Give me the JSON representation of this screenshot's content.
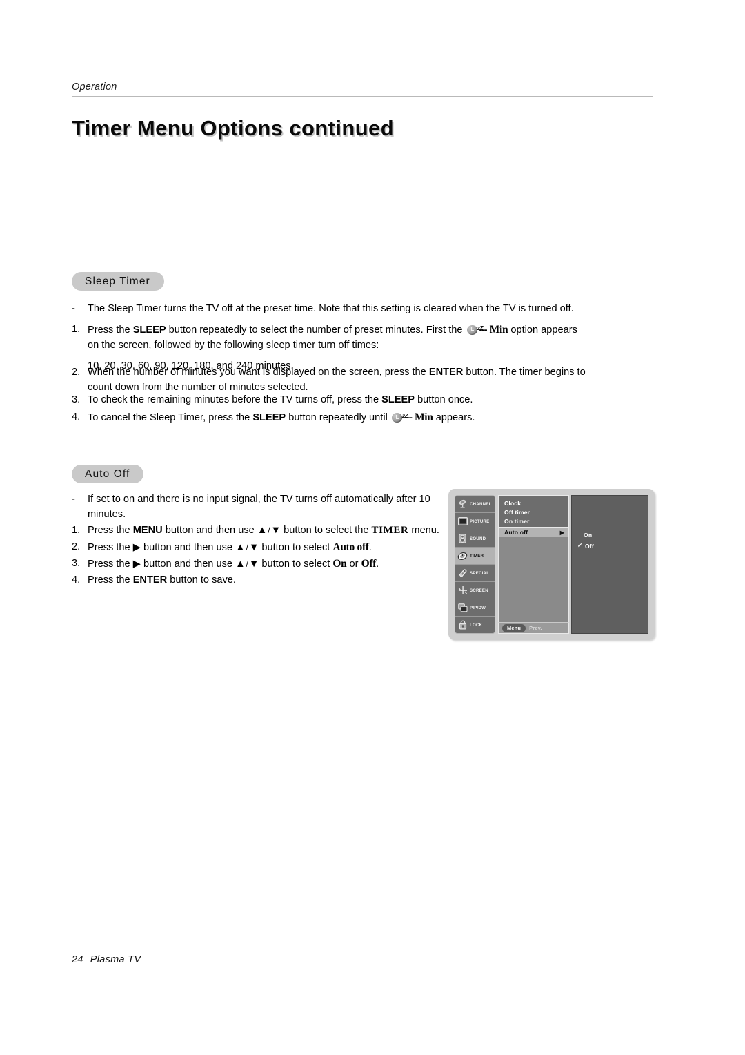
{
  "header": {
    "label": "Operation",
    "title": "Timer Menu Options continued"
  },
  "sections": {
    "sleep": {
      "pill": "Sleep Timer",
      "bullet_marker": "-",
      "bullet": "The Sleep Timer turns the TV off at the preset time. Note that this setting is cleared when the TV is turned off.",
      "steps": [
        {
          "marker": "1.",
          "part1": "Press the ",
          "bold1": "SLEEP",
          "part2": " button repeatedly to select the number of preset minutes. First the",
          "icon": "sleep-timer-icon",
          "dashes": "---",
          "bold2": "Min",
          "part3": " option appears",
          "line2": "on the screen, followed by the following sleep timer turn off times:",
          "line3": "10, 20, 30, 60, 90, 120, 180, and 240 minutes."
        },
        {
          "marker": "2.",
          "part1": "When the number of minutes you want is displayed on the screen, press the ",
          "bold1": "ENTER",
          "part2": " button. The timer begins to",
          "line2": "count down from the number of minutes selected."
        },
        {
          "marker": "3.",
          "part1": "To check the remaining minutes before the TV turns off, press the ",
          "bold1": "SLEEP",
          "part2": " button once."
        },
        {
          "marker": "4.",
          "part1": "To cancel the Sleep Timer, press the ",
          "bold1": "SLEEP",
          "part2": " button repeatedly until",
          "icon": "sleep-timer-icon",
          "dashes": "---",
          "bold2": "Min",
          "part3": " appears."
        }
      ]
    },
    "auto_off": {
      "pill": "Auto Off",
      "bullet_marker": "-",
      "bullet_line1": "If set to on and there is no input signal, the TV turns off automatically after 10",
      "bullet_line2": "minutes.",
      "steps": [
        {
          "marker": "1.",
          "part1": "Press the ",
          "bold1": "MENU",
          "part2": " button and then use ",
          "up": "▲",
          "slash": "/",
          "down": "▼",
          "part3": " button to select the ",
          "bold2": "TIMER",
          "part4": " menu."
        },
        {
          "marker": "2.",
          "part1": "Press the ",
          "right": "▶",
          "part2": " button and then use ",
          "up": "▲",
          "slash": "/",
          "down": "▼",
          "part3": " button to select ",
          "bold2": "Auto off",
          "part4": "."
        },
        {
          "marker": "3.",
          "part1": "Press the ",
          "right": "▶",
          "part2": " button and then use ",
          "up": "▲",
          "slash": "/",
          "down": "▼",
          "part3": " button to select ",
          "bold2": "On",
          "part4": " or ",
          "bold3": "Off",
          "part5": "."
        },
        {
          "marker": "4.",
          "part1": "Press the ",
          "bold1": "ENTER",
          "part2": " button to save."
        }
      ]
    }
  },
  "osd": {
    "sidebar": [
      {
        "label": "CHANNEL",
        "icon": "satellite-dish-icon",
        "selected": false
      },
      {
        "label": "PICTURE",
        "icon": "tv-screen-icon",
        "selected": false
      },
      {
        "label": "SOUND",
        "icon": "speaker-icon",
        "selected": false
      },
      {
        "label": "TIMER",
        "icon": "clock-icon",
        "selected": true
      },
      {
        "label": "SPECIAL",
        "icon": "remote-control-icon",
        "selected": false
      },
      {
        "label": "SCREEN",
        "icon": "crosshair-icon",
        "selected": false
      },
      {
        "label": "PIP/DW",
        "icon": "picture-in-picture-icon",
        "selected": false
      },
      {
        "label": "LOCK",
        "icon": "padlock-icon",
        "selected": false
      }
    ],
    "menu_items": [
      "Clock",
      "Off timer",
      "On timer"
    ],
    "selected_item": {
      "label": "Auto off",
      "arrow": "▶"
    },
    "options": [
      {
        "label": "On",
        "checked": false,
        "check": "✓"
      },
      {
        "label": "Off",
        "checked": true,
        "check": "✓"
      }
    ],
    "footer": {
      "menu_pill": "Menu",
      "prev": "Prev."
    }
  },
  "footer": {
    "page_number": "24",
    "product": "Plasma TV"
  },
  "colors": {
    "pill_bg": "#c9c9c9",
    "osd_frame": "#cfcfcf",
    "osd_dark": "#6d6d6d",
    "osd_selected": "#b3b3b3",
    "osd_right_panel": "#5f5f5f",
    "rule": "#b9b9b9"
  }
}
